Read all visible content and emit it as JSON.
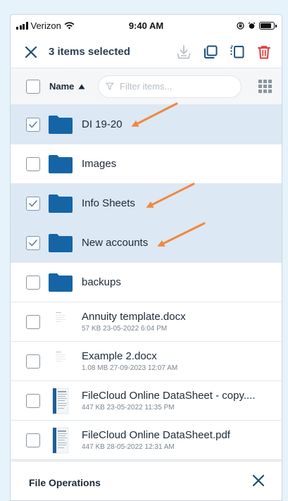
{
  "status_bar": {
    "carrier": "Verizon",
    "time": "9:40 AM",
    "battery_level": 0.85
  },
  "toolbar": {
    "close_icon": "close-icon",
    "selected_text": "3 items selected",
    "actions": [
      {
        "icon": "download-icon",
        "enabled": false
      },
      {
        "icon": "copy-icon",
        "enabled": true
      },
      {
        "icon": "move-icon",
        "enabled": true
      },
      {
        "icon": "trash-icon",
        "enabled": true
      }
    ],
    "accent_color": "#1a4f7a",
    "delete_color": "#e23b3b"
  },
  "list_header": {
    "name_label": "Name",
    "sort_icon": "sort-ascending-icon",
    "filter_placeholder": "Filter items...",
    "filter_value": "",
    "view_toggle_icon": "grid-view-icon"
  },
  "items": [
    {
      "type": "folder",
      "name": "DI 19-20",
      "selected": true
    },
    {
      "type": "folder",
      "name": "Images",
      "selected": false
    },
    {
      "type": "folder",
      "name": "Info Sheets",
      "selected": true
    },
    {
      "type": "folder",
      "name": "New accounts",
      "selected": true
    },
    {
      "type": "folder",
      "name": "backups",
      "selected": false
    },
    {
      "type": "file",
      "name": "Annuity template.docx",
      "meta": "57 KB 23-05-2022 6:04 PM",
      "selected": false
    },
    {
      "type": "file",
      "name": "Example 2.docx",
      "meta": "1.08 MB 27-09-2023 12:07 AM",
      "selected": false
    },
    {
      "type": "file",
      "name": "FileCloud Online DataSheet - copy....",
      "meta": "447 KB 23-05-2022 11:35 PM",
      "selected": false
    },
    {
      "type": "file",
      "name": "FileCloud Online DataSheet.pdf",
      "meta": "447 KB 28-05-2022 12:31 AM",
      "selected": false
    }
  ],
  "bottom_sheet": {
    "title": "File Operations",
    "close_icon": "close-icon"
  },
  "colors": {
    "folder": "#1565a6",
    "selected_row": "#dce8f3",
    "annotation_arrow": "#f0883e",
    "page_background": "#e6f3fb"
  }
}
